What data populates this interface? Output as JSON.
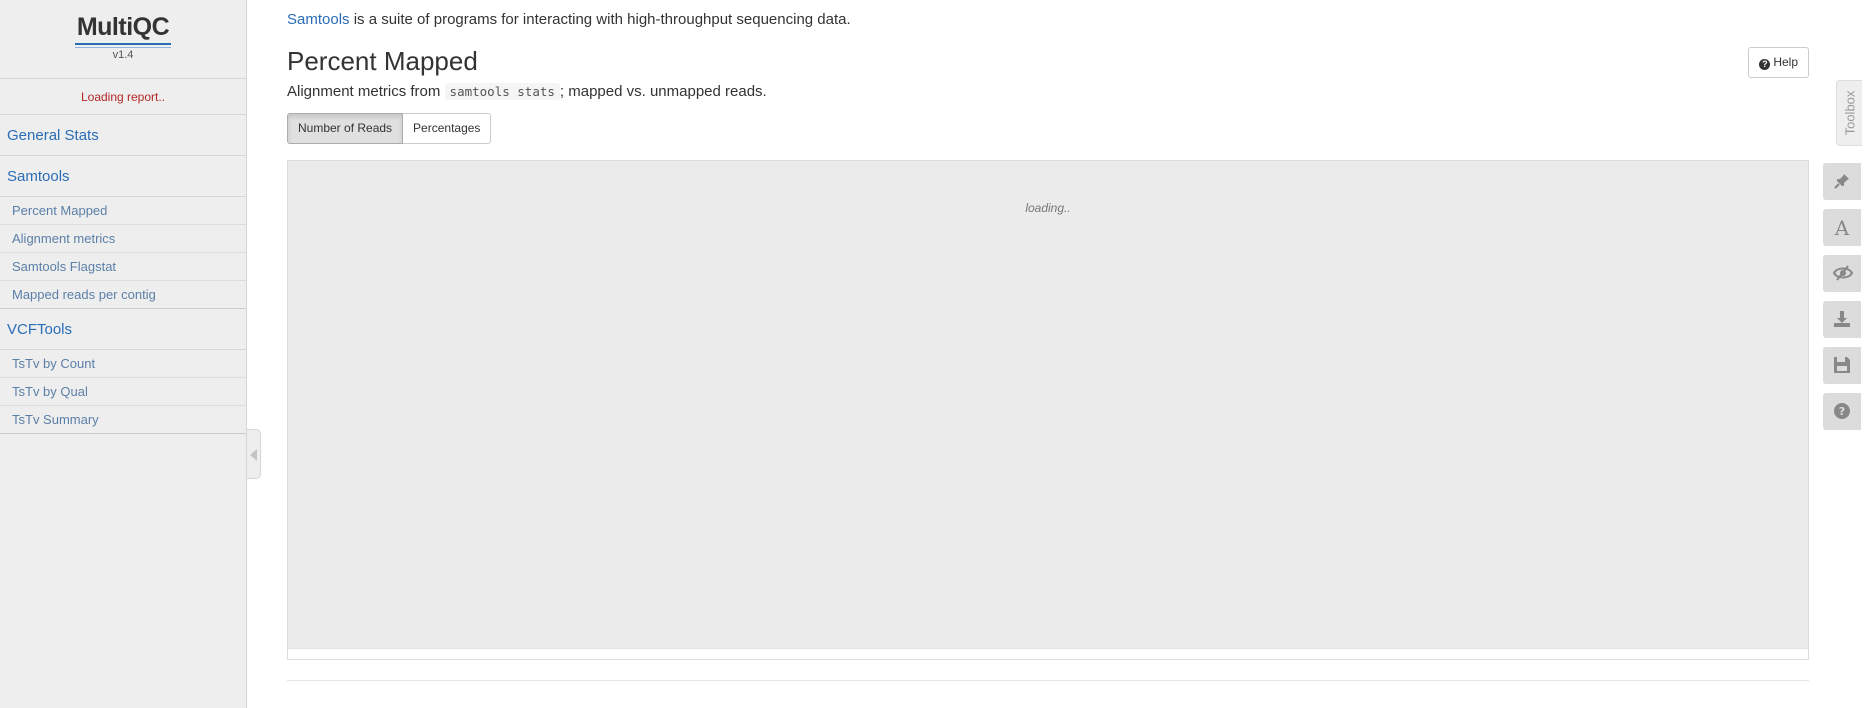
{
  "app": {
    "logo_text": "MultiQC",
    "version": "v1.4",
    "loading_message": "Loading report.."
  },
  "sidebar": {
    "sections": [
      {
        "label": "General Stats",
        "subitems": []
      },
      {
        "label": "Samtools",
        "subitems": [
          "Percent Mapped",
          "Alignment metrics",
          "Samtools Flagstat",
          "Mapped reads per contig"
        ]
      },
      {
        "label": "VCFTools",
        "subitems": [
          "TsTv by Count",
          "TsTv by Qual",
          "TsTv Summary"
        ]
      }
    ]
  },
  "main": {
    "intro_link": "Samtools",
    "intro_rest": " is a suite of programs for interacting with high-throughput sequencing data.",
    "section_title": "Percent Mapped",
    "help_label": "Help",
    "desc_prefix": "Alignment metrics from ",
    "desc_code": "samtools stats",
    "desc_suffix": "; mapped vs. unmapped reads.",
    "toggle_buttons": [
      "Number of Reads",
      "Percentages"
    ],
    "active_toggle": "Number of Reads",
    "plot_loading": "loading.."
  },
  "toolbox": {
    "label": "Toolbox",
    "buttons": [
      "pin-icon",
      "font-icon",
      "eye-slash-icon",
      "download-icon",
      "save-icon",
      "help-circle-icon"
    ]
  },
  "colors": {
    "link": "#2a6db7",
    "loading_text": "#b52626",
    "sidebar_bg": "#eeeeee",
    "plot_bg": "#ebebeb"
  }
}
